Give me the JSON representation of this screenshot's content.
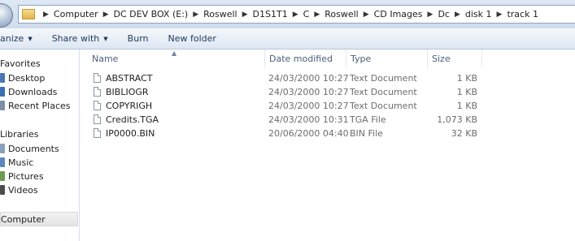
{
  "address": {
    "crumbs": [
      "Computer",
      "DC DEV BOX (E:)",
      "Roswell",
      "D1S1T1",
      "C",
      "Roswell",
      "CD Images",
      "Dc",
      "disk 1",
      "track 1"
    ]
  },
  "toolbar": {
    "organize_label": "anize",
    "share_label": "Share with",
    "burn_label": "Burn",
    "new_folder_label": "New folder"
  },
  "nav": {
    "favorites_label": "Favorites",
    "desktop_label": "Desktop",
    "downloads_label": "Downloads",
    "recent_label": "Recent Places",
    "libraries_label": "Libraries",
    "documents_label": "Documents",
    "music_label": "Music",
    "pictures_label": "Pictures",
    "videos_label": "Videos",
    "computer_label": "Computer"
  },
  "columns": {
    "name": "Name",
    "date": "Date modified",
    "type": "Type",
    "size": "Size"
  },
  "files": [
    {
      "name": "ABSTRACT",
      "date": "24/03/2000 10:27",
      "type": "Text Document",
      "size": "1 KB"
    },
    {
      "name": "BIBLIOGR",
      "date": "24/03/2000 10:27",
      "type": "Text Document",
      "size": "1 KB"
    },
    {
      "name": "COPYRIGH",
      "date": "24/03/2000 10:27",
      "type": "Text Document",
      "size": "1 KB"
    },
    {
      "name": "Credits.TGA",
      "date": "24/03/2000 10:31",
      "type": "TGA File",
      "size": "1,073 KB"
    },
    {
      "name": "IP0000.BIN",
      "date": "20/06/2000 04:40",
      "type": "BIN File",
      "size": "32 KB"
    }
  ],
  "colors": {
    "accent": "#1e395b",
    "selected": "#e4e4e4"
  },
  "icons": {
    "back": "back-arrow-icon",
    "folder": "folder-icon",
    "document": "document-icon",
    "chevron": "chevron-right-icon",
    "dropdown": "chevron-down-icon"
  }
}
